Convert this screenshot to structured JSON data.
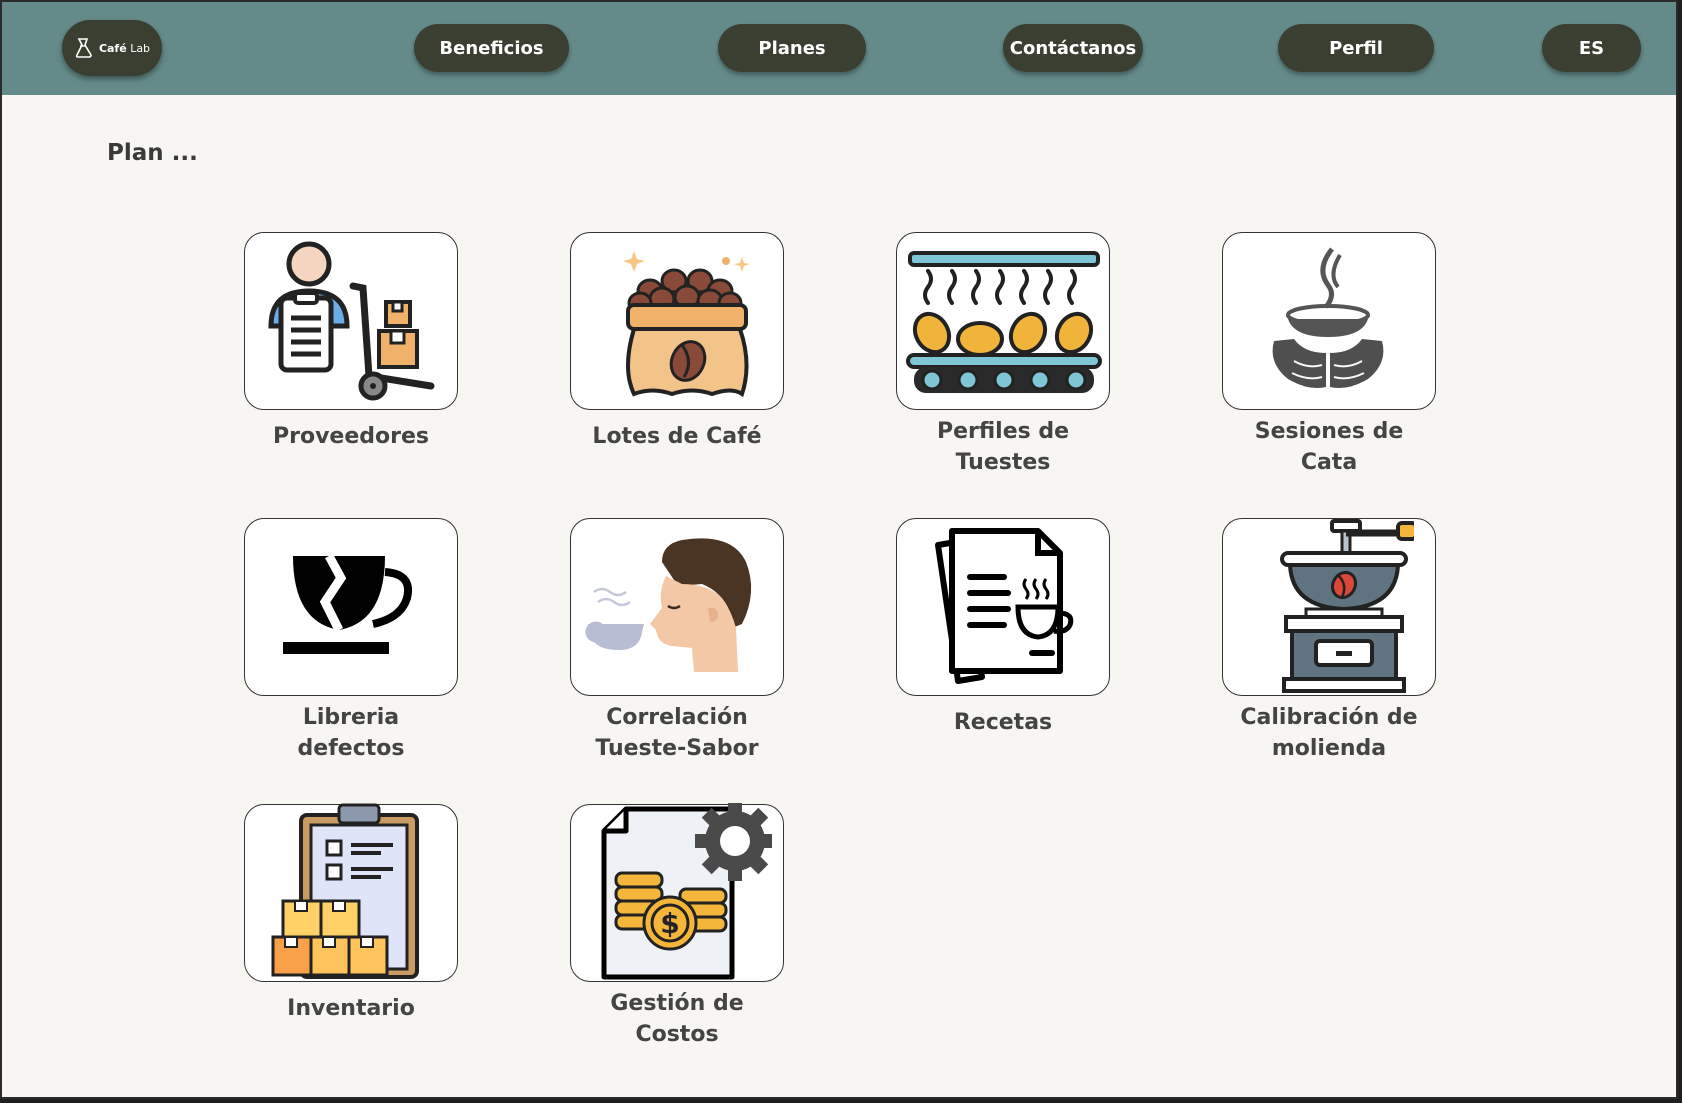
{
  "app": {
    "logo_text_bold": "Café",
    "logo_text_light": "Lab"
  },
  "nav": {
    "beneficios": "Beneficios",
    "planes": "Planes",
    "contactanos": "Contáctanos",
    "perfil": "Perfil",
    "language": "ES"
  },
  "page": {
    "title": "Plan ..."
  },
  "tiles": [
    {
      "label_1": "Proveedores",
      "label_2": "",
      "icon": "supplier-icon"
    },
    {
      "label_1": "Lotes de Café",
      "label_2": "",
      "icon": "coffee-bag-icon"
    },
    {
      "label_1": "Perfiles de",
      "label_2": "Tuestes",
      "icon": "roaster-conveyor-icon"
    },
    {
      "label_1": "Sesiones de",
      "label_2": "Cata",
      "icon": "cupping-hands-icon"
    },
    {
      "label_1": "Libreria",
      "label_2": "defectos",
      "icon": "broken-cup-icon"
    },
    {
      "label_1": "Correlación",
      "label_2": "Tueste-Sabor",
      "icon": "tasting-face-icon"
    },
    {
      "label_1": "Recetas",
      "label_2": "",
      "icon": "recipe-document-icon"
    },
    {
      "label_1": "Calibración de",
      "label_2": "molienda",
      "icon": "coffee-grinder-icon"
    },
    {
      "label_1": "Inventario",
      "label_2": "",
      "icon": "inventory-clipboard-icon"
    },
    {
      "label_1": "Gestión de",
      "label_2": "Costos",
      "icon": "cost-management-icon"
    }
  ],
  "colors": {
    "navbar": "#648b8a",
    "pill": "#3b3f31",
    "page_bg": "#f7f6f2",
    "text": "#444444"
  }
}
